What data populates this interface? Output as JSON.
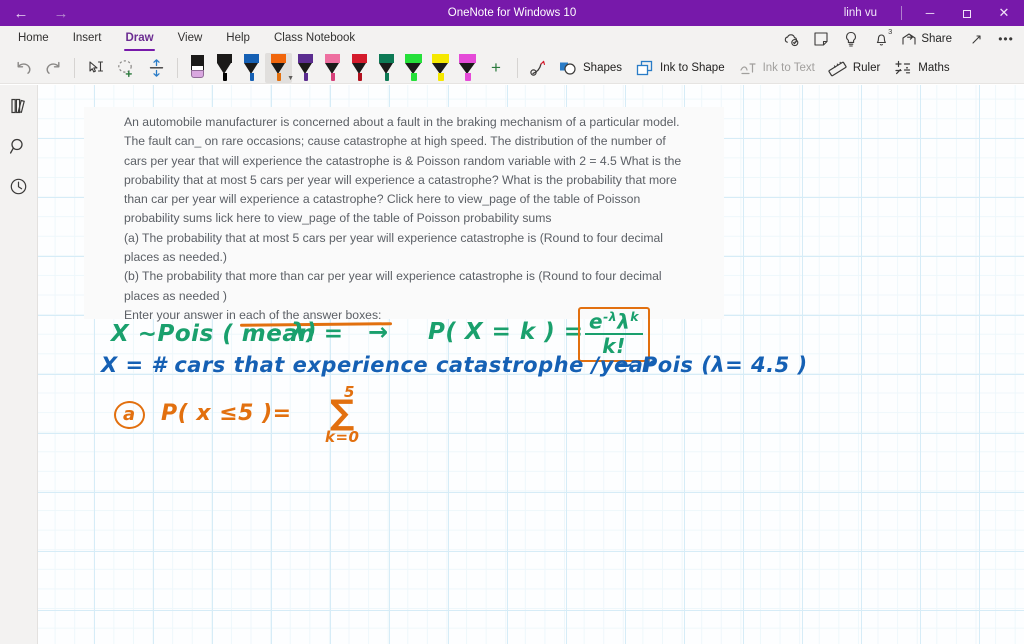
{
  "titlebar": {
    "back_label": "←",
    "forward_label": "→",
    "title": "OneNote for Windows 10",
    "user": "linh vu",
    "minimize_label": "─",
    "restore_label": "❐",
    "close_label": "✕"
  },
  "ribbon": {
    "tabs": [
      {
        "label": "Home",
        "active": false
      },
      {
        "label": "Insert",
        "active": false
      },
      {
        "label": "Draw",
        "active": true
      },
      {
        "label": "View",
        "active": false
      },
      {
        "label": "Help",
        "active": false
      },
      {
        "label": "Class Notebook",
        "active": false
      }
    ],
    "right": {
      "sync_icon": "sync-cloud-icon",
      "sticky_note_icon": "sticky-note-icon",
      "tell_me_icon": "lightbulb-icon",
      "notifications_icon": "bell-icon",
      "notifications_count": "3",
      "share_label": "Share",
      "expand_icon": "expand-diagonal-icon",
      "more_label": "•••"
    }
  },
  "toolbar": {
    "undo_label": "Undo",
    "redo_label": "Redo",
    "select_text_label": "Select text",
    "lasso_label": "Lasso Select",
    "insert_space_label": "Insert Space",
    "eraser_label": "Eraser",
    "pens": [
      {
        "name": "pen-black",
        "cap": "#1b1a19",
        "ink": "#000000",
        "type": "pen",
        "selected": false
      },
      {
        "name": "pen-blue",
        "cap": "#1560b4",
        "ink": "#1560b4",
        "type": "pen",
        "selected": false
      },
      {
        "name": "pen-orange",
        "cap": "#f1660c",
        "ink": "#e2700f",
        "type": "pen",
        "selected": true
      },
      {
        "name": "pen-purple",
        "cap": "#5b2d90",
        "ink": "#5b2d90",
        "type": "pen",
        "selected": false
      },
      {
        "name": "pen-pink",
        "cap": "#ee6fa0",
        "ink": "#d6407a",
        "type": "pen",
        "selected": false
      },
      {
        "name": "pen-red",
        "cap": "#d41b2c",
        "ink": "#b3121f",
        "type": "pen",
        "selected": false
      },
      {
        "name": "pen-green",
        "cap": "#0d7a55",
        "ink": "#0d7a55",
        "type": "pen",
        "selected": false
      },
      {
        "name": "highlighter-green",
        "cap": "#25e03a",
        "ink": "#25e03a",
        "type": "highlighter",
        "selected": false
      },
      {
        "name": "highlighter-yellow",
        "cap": "#f5e800",
        "ink": "#f5e800",
        "type": "highlighter",
        "selected": false
      },
      {
        "name": "highlighter-magenta",
        "cap": "#e54bd8",
        "ink": "#e54bd8",
        "type": "highlighter",
        "selected": false
      }
    ],
    "add_pen_label": "+",
    "ink_replay_label": "Ink Replay",
    "shapes_label": "Shapes",
    "ink_to_shape_label": "Ink to Shape",
    "ink_to_text_label": "Ink to Text",
    "ink_to_text_disabled": true,
    "ruler_label": "Ruler",
    "maths_label": "Maths"
  },
  "left_rail": {
    "notebooks_label": "Show Notebooks",
    "search_label": "Search",
    "recent_label": "Recent Notes"
  },
  "page": {
    "printed_text": [
      "An automobile manufacturer is concerned about a fault in the braking mechanism of a particular model.",
      "The fault can_ on rare occasions; cause catastrophe at high speed. The distribution of the number of",
      "cars per year that will experience the catastrophe is & Poisson random variable with 2 = 4.5 What is the",
      "probability that at most 5 cars per year will experience a catastrophe? What is the probability that more",
      "than car per year will experience a catastrophe? Click here to view_page of the table of Poisson",
      "probability sums lick here to view_page of the table of Poisson probability sums",
      "(a) The probability that at most 5 cars per year will experience catastrophe is (Round to four decimal",
      "places as needed.)",
      "(b) The probability that more than car per year will experience catastrophe is (Round to four decimal",
      "places as needed )",
      "Enter your answer in each of the answer boxes:"
    ],
    "ink": {
      "line1_green_left": "X ~Pois ( mean =",
      "line1_green_lambda": "λ)",
      "line1_arrow": "→",
      "line1_green_pxk": "P( X = k ) =",
      "formula_numerator": "e",
      "formula_num_exp1": "-λ",
      "formula_num_lambda": "λ",
      "formula_num_exp2": "k",
      "formula_denominator": "k!",
      "line2_blue": "X =   # cars that experience catastrophe /year",
      "line2_blue_tail": "~ Pois (λ= 4.5 )",
      "line3_marker": "a",
      "line3_expr": "P( x ≤5 )=",
      "sigma": "∑",
      "sigma_top": "5",
      "sigma_bottom": "k=0"
    }
  },
  "colors": {
    "brand_purple": "#7719aa",
    "ink_green": "#1aa06d",
    "ink_blue": "#1560b4",
    "ink_orange": "#e2700f",
    "grid_line": "#d6ecf7"
  }
}
